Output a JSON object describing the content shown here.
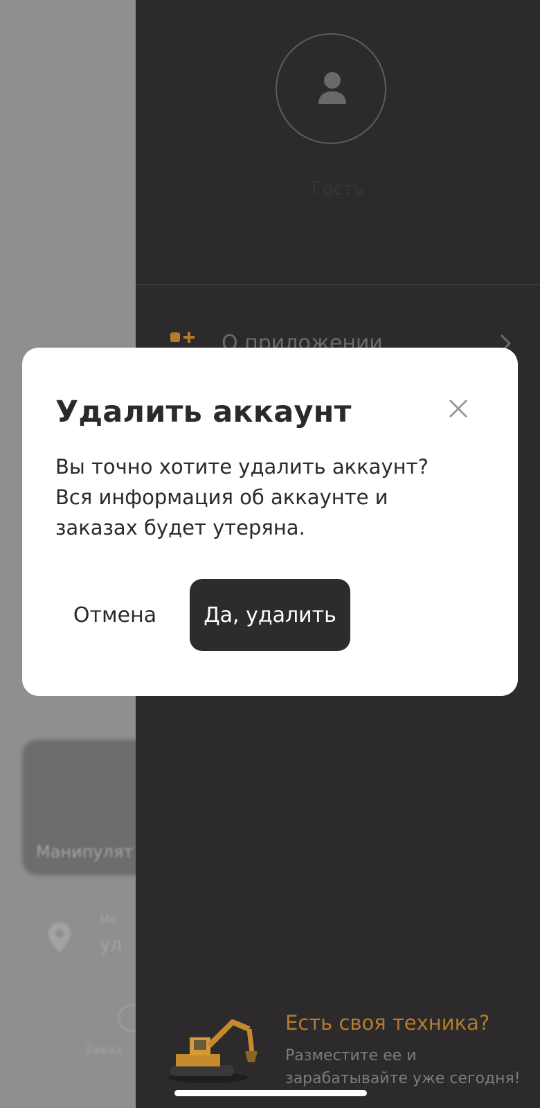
{
  "background": {
    "card_label": "Манипулят",
    "location_label": "Ме",
    "location_value": "ул",
    "order_label": "Заказ"
  },
  "drawer": {
    "user_name": "Гость",
    "menu_items": [
      {
        "label": "О приложении",
        "icon": "app-add-icon"
      }
    ],
    "promo": {
      "title": "Есть своя техника?",
      "subtitle": "Разместите ее и зарабатывайте уже сегодня!",
      "image": "excavator-icon"
    }
  },
  "modal": {
    "title": "Удалить аккаунт",
    "message": "Вы точно хотите удалить аккаунт? Вся информация об аккаунте и заказах будет утеряна.",
    "cancel_label": "Отмена",
    "confirm_label": "Да, удалить",
    "close_icon": "close-icon"
  },
  "colors": {
    "accent": "#b47b2d",
    "drawer_bg": "#2c2a2b",
    "modal_bg": "#ffffff",
    "button_dark": "#2d2b2c"
  }
}
